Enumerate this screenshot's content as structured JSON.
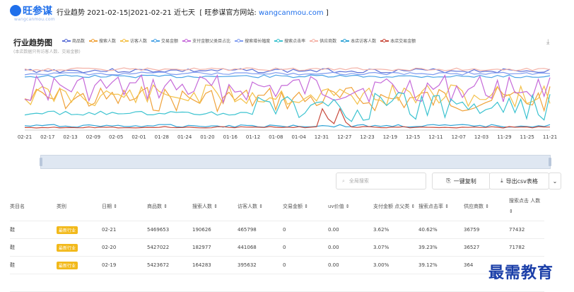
{
  "header": {
    "logo_text": "旺参谋",
    "logo_sub": "wangcanmou.com",
    "title": "行业趋势 2021-02-15|2021-02-21 近七天",
    "site_prefix": "[ 旺参谋官方网站: ",
    "site_url": "wangcanmou.com",
    "site_suffix": " ]"
  },
  "chart": {
    "title": "行业趋势图",
    "note": "(本店数据只有访客人数、交易金额)",
    "download_icon": "download-icon"
  },
  "chart_data": {
    "type": "line",
    "x": [
      "02-21",
      "02-17",
      "02-13",
      "02-09",
      "02-05",
      "02-01",
      "01-28",
      "01-24",
      "01-20",
      "01-16",
      "01-12",
      "01-08",
      "01-04",
      "12-31",
      "12-27",
      "12-23",
      "12-19",
      "12-15",
      "12-11",
      "12-07",
      "12-03",
      "11-29",
      "11-25",
      "11-21"
    ],
    "legend_placement": "top",
    "grid": false,
    "series": [
      {
        "name": "商品数",
        "color": "#5b6fd6"
      },
      {
        "name": "搜索人数",
        "color": "#f0a23a"
      },
      {
        "name": "访客人数",
        "color": "#f3c14a"
      },
      {
        "name": "交易金额",
        "color": "#4aa3e6"
      },
      {
        "name": "支付金额父类目占比",
        "color": "#c56ad9"
      },
      {
        "name": "搜索增长幅度",
        "color": "#7f9cf0"
      },
      {
        "name": "搜索点击率",
        "color": "#3cc3d0"
      },
      {
        "name": "供应商数",
        "color": "#f4b3a8"
      },
      {
        "name": "本店访客人数",
        "color": "#2fa3d6"
      },
      {
        "name": "本店交易金额",
        "color": "#c84a3c"
      }
    ]
  },
  "toolbar": {
    "search_placeholder": "全局搜索",
    "copy_label": "一键复制",
    "export_label": "导出csv表格",
    "dropdown_icon": "chevron-down-icon"
  },
  "table": {
    "headers": [
      "类目名",
      "类别",
      "日期 ⇕",
      "商品数 ⇕",
      "搜索人数 ⇕",
      "访客人数 ⇕",
      "交易金额 ⇕",
      "uv价值 ⇕",
      "支付金额 点父类 ⇕",
      "搜索点击率 ⇕",
      "供应商数 ⇕",
      "搜索点击 人数 ⇕"
    ],
    "rows": [
      [
        "鞋",
        "最新行业",
        "02-21",
        "5469653",
        "190626",
        "465798",
        "0",
        "0.00",
        "3.62%",
        "40.62%",
        "36759",
        "77432"
      ],
      [
        "鞋",
        "最新行业",
        "02-20",
        "5427022",
        "182977",
        "441068",
        "0",
        "0.00",
        "3.07%",
        "39.23%",
        "36527",
        "71782"
      ],
      [
        "鞋",
        "最新行业",
        "02-19",
        "5423672",
        "164283",
        "395632",
        "0",
        "0.00",
        "3.00%",
        "39.12%",
        "364",
        ""
      ],
      [
        "",
        "",
        "",
        "",
        "",
        "",
        "",
        "",
        "",
        "",
        "",
        ""
      ]
    ]
  },
  "watermark": "最需教育"
}
